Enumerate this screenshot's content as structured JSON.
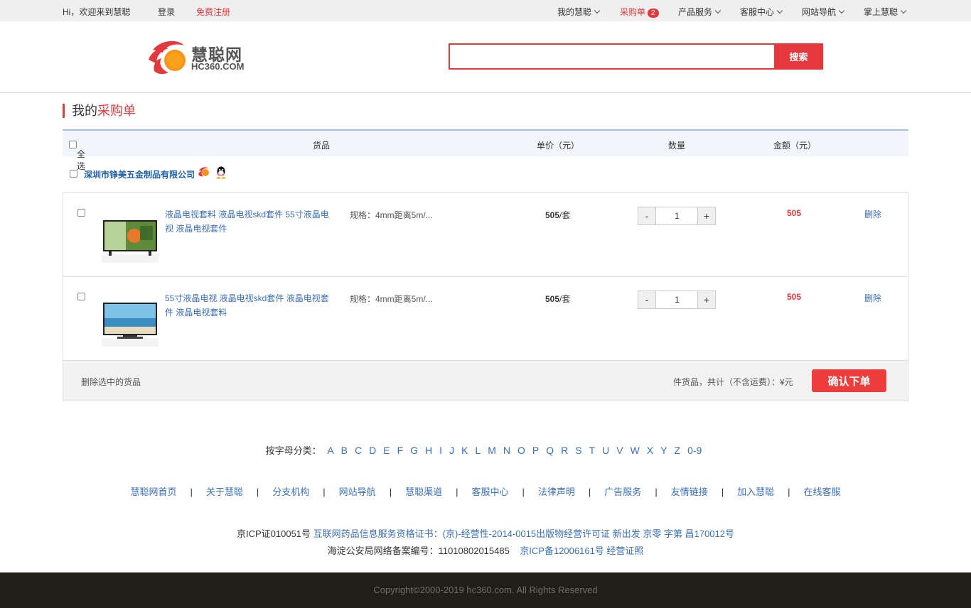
{
  "topbar": {
    "greeting": "Hi，欢迎来到慧聪",
    "login": "登录",
    "register": "免费注册",
    "my_hc": "我的慧聪",
    "purchase_list": "采购单",
    "purchase_count": "2",
    "products": "产品服务",
    "service": "客服中心",
    "nav": "网站导航",
    "mobile": "掌上慧聪"
  },
  "header": {
    "logo_text": "慧聪网",
    "logo_sub": "HC360.COM",
    "search_value": "",
    "search_button": "搜索"
  },
  "page": {
    "title_prefix": "我的",
    "title_highlight": "采购单"
  },
  "table": {
    "select_all": "全选",
    "col_goods": "货品",
    "col_price": "单价（元）",
    "col_qty": "数量",
    "col_amount": "金额（元）"
  },
  "shop": {
    "name": "深圳市铮美五金制品有限公司"
  },
  "items": [
    {
      "title": "液晶电视套料 液晶电视skd套件 55寸液晶电视 液晶电视套件",
      "spec": "规格：4mm距离5m/...",
      "price": "505",
      "unit": "/套",
      "minus": "-",
      "qty": "1",
      "plus": "+",
      "amount": "505",
      "delete": "删除"
    },
    {
      "title": "55寸液晶电视 液晶电视skd套件 液晶电视套件 液晶电视套料",
      "spec": "规格：4mm距离5m/...",
      "price": "505",
      "unit": "/套",
      "minus": "-",
      "qty": "1",
      "plus": "+",
      "amount": "505",
      "delete": "删除"
    }
  ],
  "summary": {
    "delete_selected": "删除选中的货品",
    "total": "件货品，共计（不含运费）：¥元",
    "confirm": "确认下单"
  },
  "alphabet": {
    "label": "按字母分类：",
    "letters": [
      "A",
      "B",
      "C",
      "D",
      "E",
      "F",
      "G",
      "H",
      "I",
      "J",
      "K",
      "L",
      "M",
      "N",
      "O",
      "P",
      "Q",
      "R",
      "S",
      "T",
      "U",
      "V",
      "W",
      "X",
      "Y",
      "Z",
      "0-9"
    ]
  },
  "footer_links": [
    "慧聪网首页",
    "关于慧聪",
    "分支机构",
    "网站导航",
    "慧聪渠道",
    "客服中心",
    "法律声明",
    "广告服务",
    "友情链接",
    "加入慧聪",
    "在线客服"
  ],
  "footer_sep": "|",
  "icp": {
    "line1_prefix": "京ICP证010051号",
    "line1_link": "互联网药品信息服务资格证书：(京)-经营性-2014-0015出版物经营许可证 新出发 京零 字第 昌170012号",
    "line2_prefix": "海淀公安局网络备案编号：11010802015485",
    "line2_link": "京ICP备12006161号 经营证照"
  },
  "copyright": "Copyright©2000-2019 hc360.com. All Rights Reserved",
  "colors": {
    "accent": "#e4393c",
    "link": "#3b6fb6"
  }
}
